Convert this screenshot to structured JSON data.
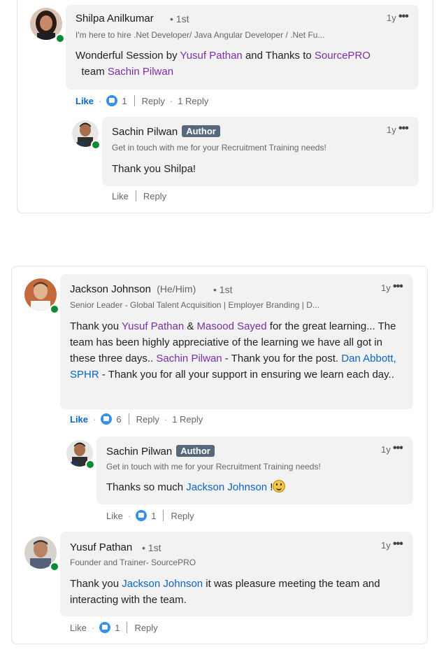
{
  "colors": {
    "accent": "#0a66c2",
    "mention": "#7b2ea6",
    "online": "#0a8a35",
    "author_badge": "#56687a"
  },
  "thread1": {
    "comment": {
      "name": "Shilpa Anilkumar",
      "degree": "• 1st",
      "headline": "I'm here to hire .Net Developer/ Java Angular Developer / .Net Fu...",
      "time": "1y",
      "more": "•••",
      "body": {
        "p1": "Wonderful Session by ",
        "m1": "Yusuf Pathan",
        "p2": " and Thanks to ",
        "m2": "SourcePRO",
        "p3": " team ",
        "m3": "Sachin Pilwan"
      },
      "actions": {
        "like": "Like",
        "reaction_count": "1",
        "reply": "Reply",
        "replies": "1 Reply"
      }
    },
    "reply": {
      "name": "Sachin Pilwan",
      "badge": "Author",
      "headline": "Get in touch with me for your Recruitment Training needs!",
      "time": "1y",
      "more": "•••",
      "body": "Thank you Shilpa!",
      "actions": {
        "like": "Like",
        "reply": "Reply"
      }
    }
  },
  "thread2": {
    "comment": {
      "name": "Jackson Johnson",
      "pronouns": "(He/Him)",
      "degree": "• 1st",
      "headline": "Senior Leader - Global Talent Acquisition | Employer Branding | D...",
      "time": "1y",
      "more": "•••",
      "body": {
        "p1": "Thank you ",
        "m1": "Yusuf Pathan",
        "p2": " & ",
        "m2": "Masood Sayed",
        "p3": " for the great learning... The team has been highly appreciative of the learning we have all got in these three days.. ",
        "m3": "Sachin Pilwan",
        "p4": " - Thank you for the post. ",
        "m4": "Dan Abbott, SPHR",
        "p5": " - Thank you for all your support in ensuring we learn each day.."
      },
      "actions": {
        "like": "Like",
        "reaction_count": "6",
        "reply": "Reply",
        "replies": "1 Reply"
      }
    },
    "reply1": {
      "name": "Sachin Pilwan",
      "badge": "Author",
      "headline": "Get in touch with me for your Recruitment Training needs!",
      "time": "1y",
      "more": "•••",
      "body": {
        "p1": "Thanks so much ",
        "m1": "Jackson Johnson",
        "p2": " !"
      },
      "actions": {
        "like": "Like",
        "reaction_count": "1",
        "reply": "Reply"
      }
    },
    "reply2": {
      "name": "Yusuf Pathan",
      "degree": "• 1st",
      "headline": "Founder and Trainer- SourcePRO",
      "time": "1y",
      "more": "•••",
      "body": {
        "p1": "Thank you ",
        "m1": "Jackson Johnson",
        "p2": " it was pleasure meeting the team and interacting with the team."
      },
      "actions": {
        "like": "Like",
        "reaction_count": "1",
        "reply": "Reply"
      }
    }
  }
}
